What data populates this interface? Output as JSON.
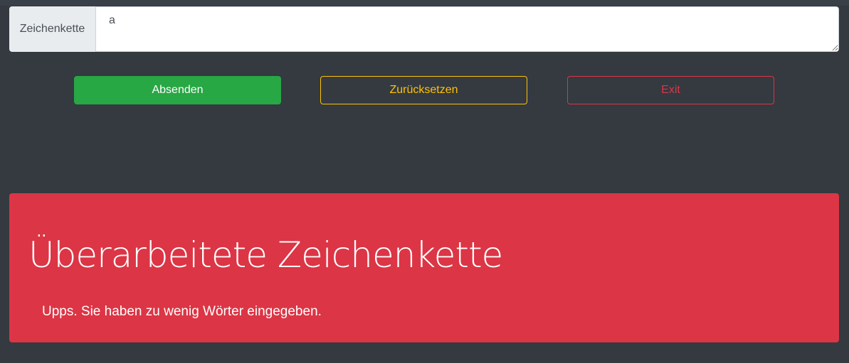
{
  "form": {
    "label": "Zeichenkette",
    "input_value": "a"
  },
  "buttons": {
    "submit_label": "Absenden",
    "reset_label": "Zurücksetzen",
    "exit_label": "Exit"
  },
  "result": {
    "title": "Überarbeitete Zeichenkette",
    "message": "Upps. Sie haben zu wenig Wörter eingegeben."
  },
  "colors": {
    "background": "#343a40",
    "success": "#28a745",
    "warning": "#ffc107",
    "danger": "#dc3545"
  }
}
